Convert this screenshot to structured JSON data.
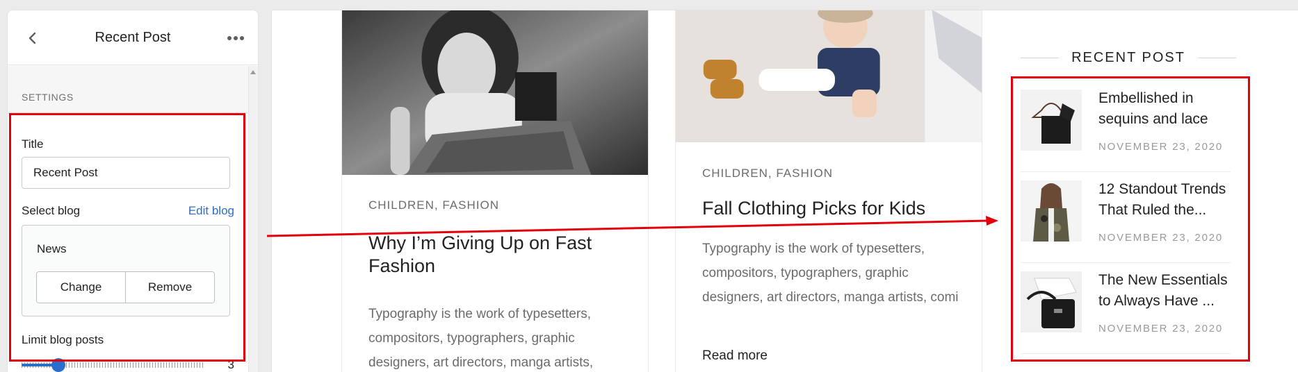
{
  "panel": {
    "title": "Recent Post",
    "section_label": "SETTINGS",
    "title_label": "Title",
    "title_value": "Recent Post",
    "select_blog_label": "Select blog",
    "edit_blog_link": "Edit blog",
    "selected_blog": "News",
    "change_button": "Change",
    "remove_button": "Remove",
    "limit_label": "Limit blog posts",
    "limit_value": "3",
    "slider_fraction": 0.2,
    "accent_color": "#2c6ecb"
  },
  "posts": [
    {
      "categories": "CHILDREN, FASHION",
      "title": "Why I’m Giving Up on Fast Fashion",
      "excerpt": "Typography is the work of typesetters, compositors, typographers, graphic designers, art directors, manga artists,"
    },
    {
      "categories": "CHILDREN, FASHION",
      "title": "Fall Clothing Picks for Kids",
      "excerpt": "Typography is the work of typesetters, compositors, typographers, graphic designers, art directors, manga artists, comi",
      "read_more": "Read more"
    }
  ],
  "recent_widget": {
    "title": "RECENT POST",
    "items": [
      {
        "title": "Embellished in sequins and lace",
        "date": "NOVEMBER 23, 2020"
      },
      {
        "title": "12 Standout Trends That Ruled the...",
        "date": "NOVEMBER 23, 2020"
      },
      {
        "title": "The New Essentials to Always Have ...",
        "date": "NOVEMBER 23, 2020"
      }
    ]
  },
  "annotation_color": "#e3000b"
}
